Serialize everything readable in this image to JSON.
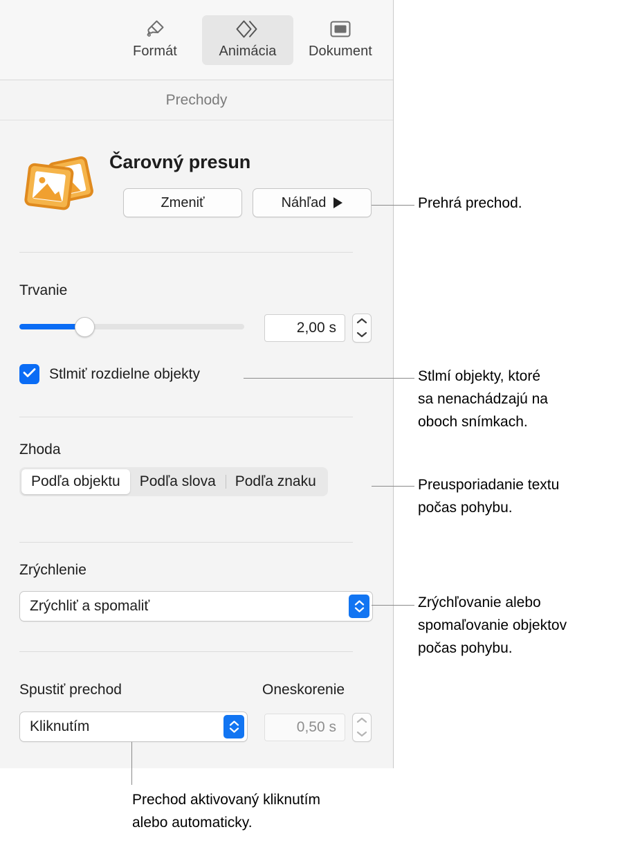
{
  "tabs": [
    {
      "id": "format",
      "label": "Formát",
      "icon": "paintbrush-icon",
      "selected": false
    },
    {
      "id": "animation",
      "label": "Animácia",
      "icon": "diamonds-icon",
      "selected": true
    },
    {
      "id": "document",
      "label": "Dokument",
      "icon": "slide-icon",
      "selected": false
    }
  ],
  "section": {
    "title": "Prechody"
  },
  "transition": {
    "name": "Čarovný presun",
    "icon": "photos-icon",
    "change_button": "Zmeniť",
    "preview_button": "Náhľad",
    "preview_icon": "play-icon"
  },
  "duration": {
    "label": "Trvanie",
    "value": "2,00 s",
    "slider_percent": 29,
    "stepper_icon": "stepper-up-down-icon"
  },
  "dim": {
    "label": "Stlmiť rozdielne objekty",
    "checked": true,
    "checkbox_icon": "checkmark-icon"
  },
  "match": {
    "label": "Zhoda",
    "options": [
      "Podľa objektu",
      "Podľa slova",
      "Podľa znaku"
    ],
    "selected_index": 0
  },
  "acceleration": {
    "label": "Zrýchlenie",
    "value": "Zrýchliť a spomaliť",
    "popup_icon": "popup-chevrons-icon"
  },
  "start": {
    "label": "Spustiť prechod",
    "value": "Kliknutím",
    "popup_icon": "popup-chevrons-icon"
  },
  "delay": {
    "label": "Oneskorenie",
    "value": "0,50 s",
    "disabled": true,
    "stepper_icon": "stepper-up-down-icon"
  },
  "callouts": {
    "preview": "Prehrá prechod.",
    "dim_line1": "Stlmí objekty, ktoré",
    "dim_line2": "sa nenachádzajú na",
    "dim_line3": "oboch snímkach.",
    "match_line1": "Preusporiadanie textu",
    "match_line2": "počas pohybu.",
    "accel_line1": "Zrýchľovanie alebo",
    "accel_line2": "spomaľovanie objektov",
    "accel_line3": "počas pohybu.",
    "start_line1": "Prechod aktivovaný kliknutím",
    "start_line2": "alebo automaticky."
  },
  "colors": {
    "accent_blue": "#0a6cf5",
    "popup_blue": "#1275f2",
    "icon_orange": "#f0a030",
    "panel_bg": "#f4f4f4",
    "text": "#1d1d1d"
  }
}
